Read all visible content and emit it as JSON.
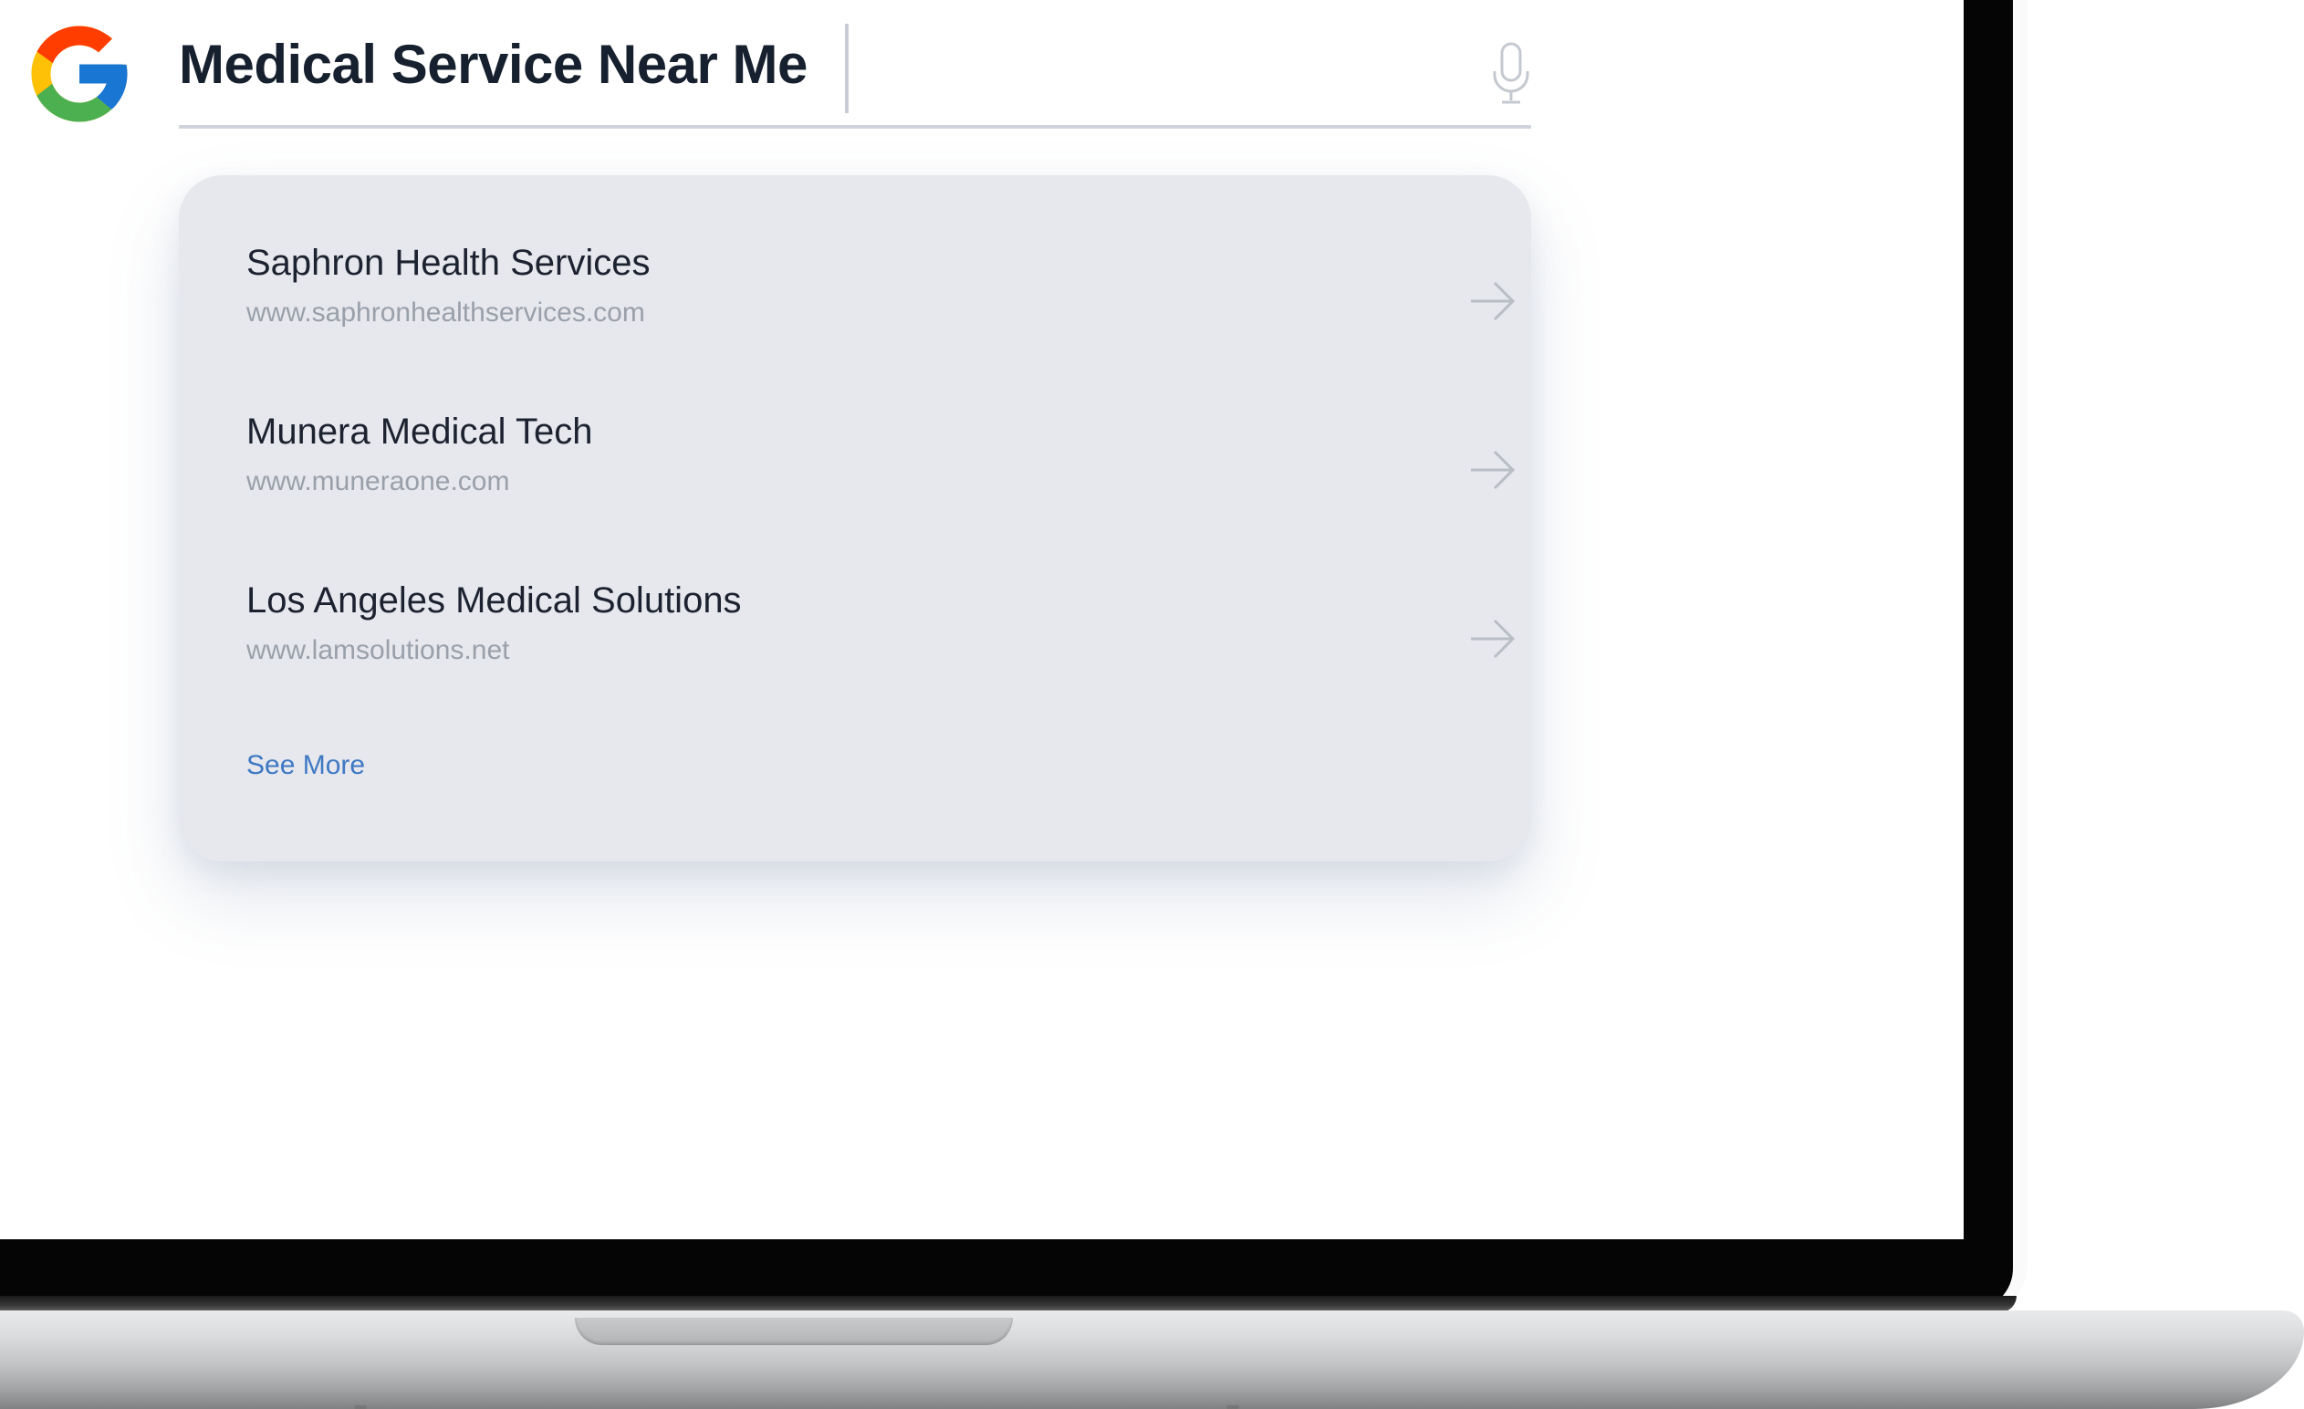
{
  "search": {
    "query": "Medical Service Near Me"
  },
  "results": [
    {
      "title": "Saphron Health Services",
      "url": "www.saphronhealthservices.com"
    },
    {
      "title": "Munera Medical Tech",
      "url": "www.muneraone.com"
    },
    {
      "title": "Los Angeles Medical Solutions",
      "url": "www.lamsolutions.net"
    }
  ],
  "see_more_label": "See More",
  "icons": {
    "logo": "google-logo-icon",
    "mic": "microphone-icon",
    "result_arrow": "arrow-right-icon"
  },
  "colors": {
    "query_text": "#17202e",
    "card_background": "#e6e8ed",
    "url_text": "#9aa0aa",
    "link": "#3f79c4",
    "google_blue": "#4285F4",
    "google_red": "#EA4335",
    "google_yellow": "#FBBC05",
    "google_green": "#34A853"
  }
}
